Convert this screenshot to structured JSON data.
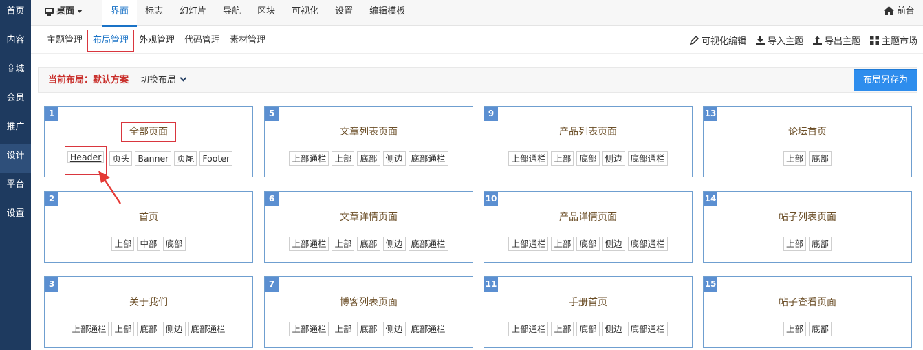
{
  "sidebar": {
    "items": [
      {
        "label": "首页"
      },
      {
        "label": "内容"
      },
      {
        "label": "商城"
      },
      {
        "label": "会员"
      },
      {
        "label": "推广"
      },
      {
        "label": "设计"
      },
      {
        "label": "平台"
      },
      {
        "label": "设置"
      }
    ],
    "active_index": 5
  },
  "topnav": {
    "desk_label": "桌面",
    "tabs": [
      {
        "label": "界面"
      },
      {
        "label": "标志"
      },
      {
        "label": "幻灯片"
      },
      {
        "label": "导航"
      },
      {
        "label": "区块"
      },
      {
        "label": "可视化"
      },
      {
        "label": "设置"
      },
      {
        "label": "编辑模板"
      }
    ],
    "active_index": 0,
    "front_label": "前台"
  },
  "subnav": {
    "tabs": [
      {
        "label": "主题管理"
      },
      {
        "label": "布局管理"
      },
      {
        "label": "外观管理"
      },
      {
        "label": "代码管理"
      },
      {
        "label": "素材管理"
      }
    ],
    "active_index": 1,
    "actions": [
      {
        "label": "可视化编辑",
        "icon": "pencil-icon"
      },
      {
        "label": "导入主题",
        "icon": "download-icon"
      },
      {
        "label": "导出主题",
        "icon": "upload-icon"
      },
      {
        "label": "主题市场",
        "icon": "grid-icon"
      }
    ]
  },
  "layout_bar": {
    "current_label": "当前布局：默认方案",
    "switch_label": "切换布局",
    "save_as_label": "布局另存为"
  },
  "cards": [
    {
      "num": "1",
      "title": "全部页面",
      "tags": [
        "Header",
        "页头",
        "Banner",
        "页尾",
        "Footer"
      ]
    },
    {
      "num": "5",
      "title": "文章列表页面",
      "tags": [
        "上部通栏",
        "上部",
        "底部",
        "侧边",
        "底部通栏"
      ]
    },
    {
      "num": "9",
      "title": "产品列表页面",
      "tags": [
        "上部通栏",
        "上部",
        "底部",
        "侧边",
        "底部通栏"
      ]
    },
    {
      "num": "13",
      "title": "论坛首页",
      "tags": [
        "上部",
        "底部"
      ]
    },
    {
      "num": "2",
      "title": "首页",
      "tags": [
        "上部",
        "中部",
        "底部"
      ]
    },
    {
      "num": "6",
      "title": "文章详情页面",
      "tags": [
        "上部通栏",
        "上部",
        "底部",
        "侧边",
        "底部通栏"
      ]
    },
    {
      "num": "10",
      "title": "产品详情页面",
      "tags": [
        "上部通栏",
        "上部",
        "底部",
        "侧边",
        "底部通栏"
      ]
    },
    {
      "num": "14",
      "title": "帖子列表页面",
      "tags": [
        "上部",
        "底部"
      ]
    },
    {
      "num": "3",
      "title": "关于我们",
      "tags": [
        "上部通栏",
        "上部",
        "底部",
        "侧边",
        "底部通栏"
      ]
    },
    {
      "num": "7",
      "title": "博客列表页面",
      "tags": [
        "上部通栏",
        "上部",
        "底部",
        "侧边",
        "底部通栏"
      ]
    },
    {
      "num": "11",
      "title": "手册首页",
      "tags": [
        "上部通栏",
        "上部",
        "底部",
        "侧边",
        "底部通栏"
      ]
    },
    {
      "num": "15",
      "title": "帖子查看页面",
      "tags": [
        "上部",
        "底部"
      ]
    }
  ],
  "colors": {
    "sidebar_bg": "#1e3a5f",
    "accent": "#1a73c7",
    "highlight": "#d9363e",
    "button": "#2e8ded"
  }
}
